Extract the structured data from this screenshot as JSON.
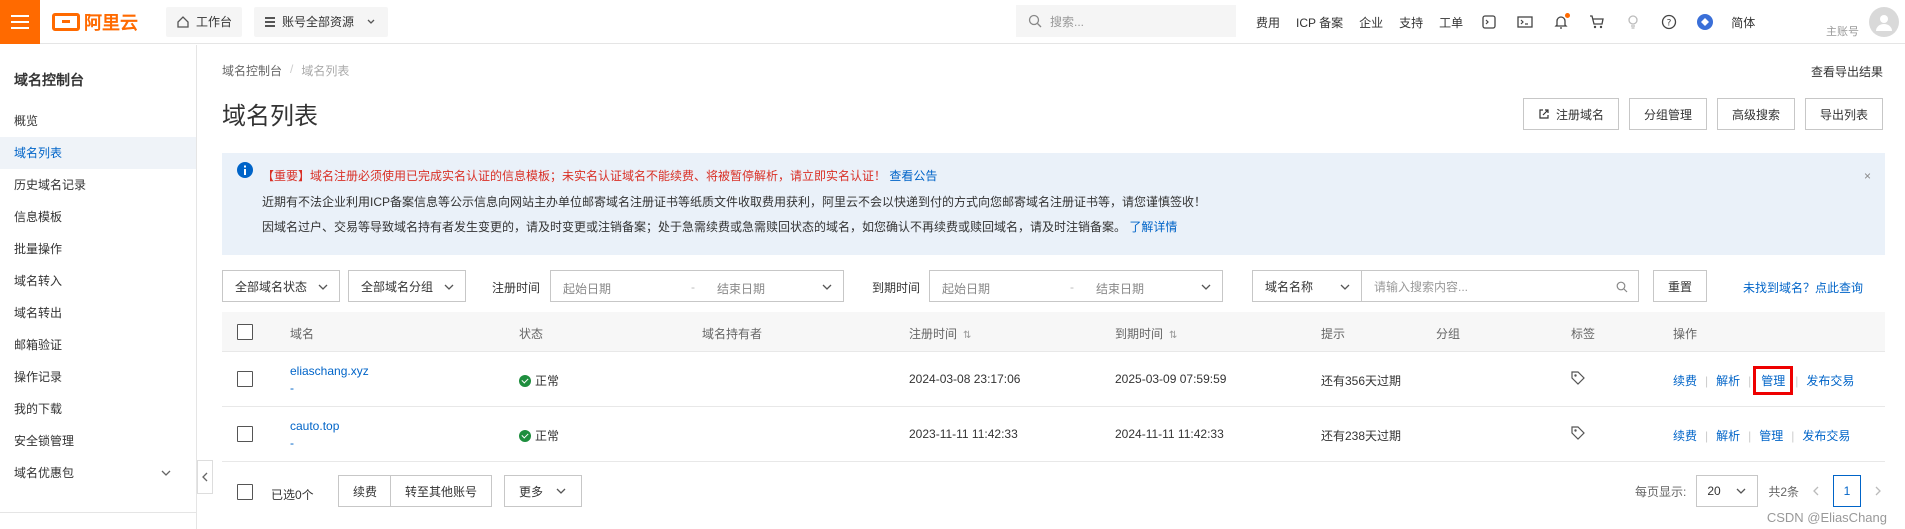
{
  "topbar": {
    "brand": "阿里云",
    "workbench": "工作台",
    "account_scope": "账号全部资源",
    "search_placeholder": "搜索...",
    "nav": [
      "费用",
      "ICP 备案",
      "企业",
      "支持",
      "工单"
    ],
    "language": "简体",
    "account_label": "主账号"
  },
  "sidebar": {
    "title": "域名控制台",
    "items": [
      {
        "label": "概览"
      },
      {
        "label": "域名列表"
      },
      {
        "label": "历史域名记录"
      },
      {
        "label": "信息模板"
      },
      {
        "label": "批量操作"
      },
      {
        "label": "域名转入"
      },
      {
        "label": "域名转出"
      },
      {
        "label": "邮箱验证"
      },
      {
        "label": "操作记录"
      },
      {
        "label": "我的下载"
      },
      {
        "label": "安全锁管理"
      },
      {
        "label": "域名优惠包"
      }
    ]
  },
  "breadcrumb": {
    "root": "域名控制台",
    "sep": "/",
    "current": "域名列表"
  },
  "export_results_link": "查看导出结果",
  "page_title": "域名列表",
  "actions": {
    "register": "注册域名",
    "group_manage": "分组管理",
    "advanced_search": "高级搜索",
    "export_list": "导出列表"
  },
  "notice": {
    "line1_important": "【重要】域名注册必须使用已完成实名认证的信息模板；未实名认证域名不能续费、将被暂停解析，请立即实名认证！",
    "line1_link": "查看公告",
    "line2": "近期有不法企业利用ICP备案信息等公示信息向网站主办单位邮寄域名注册证书等纸质文件收取费用获利，阿里云不会以快递到付的方式向您邮寄域名注册证书等，请您谨慎签收！",
    "line3": "因域名过户、交易等导致域名持有者发生变更的，请及时变更或注销备案；处于急需续费或急需赎回状态的域名，如您确认不再续费或赎回域名，请及时注销备案。",
    "line3_link": "了解详情",
    "close": "×"
  },
  "filters": {
    "status": "全部域名状态",
    "group": "全部域名分组",
    "reg_time_label": "注册时间",
    "exp_time_label": "到期时间",
    "start_date": "起始日期",
    "end_date": "结束日期",
    "range_sep": "-",
    "field": "域名名称",
    "search_placeholder": "请输入搜索内容...",
    "reset": "重置",
    "not_found_link": "未找到域名？点此查询"
  },
  "table": {
    "headers": {
      "domain": "域名",
      "status": "状态",
      "holder": "域名持有者",
      "reg_time": "注册时间",
      "exp_time": "到期时间",
      "hint": "提示",
      "group": "分组",
      "tag": "标签",
      "ops": "操作",
      "sort": "⇅"
    },
    "rows": [
      {
        "domain": "eliaschang.xyz",
        "sub": "-",
        "status": "正常",
        "reg_time": "2024-03-08 23:17:06",
        "exp_time": "2025-03-09 07:59:59",
        "hint": "还有356天过期"
      },
      {
        "domain": "cauto.top",
        "sub": "-",
        "status": "正常",
        "reg_time": "2023-11-11 11:42:33",
        "exp_time": "2024-11-11 11:42:33",
        "hint": "还有238天过期"
      }
    ],
    "ops": {
      "renew": "续费",
      "resolve": "解析",
      "manage": "管理",
      "trade": "发布交易",
      "sep": "|"
    }
  },
  "footer": {
    "selected": "已选0个",
    "renew": "续费",
    "transfer": "转至其他账号",
    "more": "更多",
    "page_size_label": "每页显示:",
    "page_size": "20",
    "total": "共2条",
    "current_page": "1"
  },
  "watermark": "CSDN @EliasChang",
  "colors": {
    "brand": "#ff6a00",
    "link": "#0064c8",
    "notice_bg": "#eaf1f9",
    "important": "#d93026",
    "success": "#1e8e3e",
    "highlight_box": "#e00000"
  }
}
